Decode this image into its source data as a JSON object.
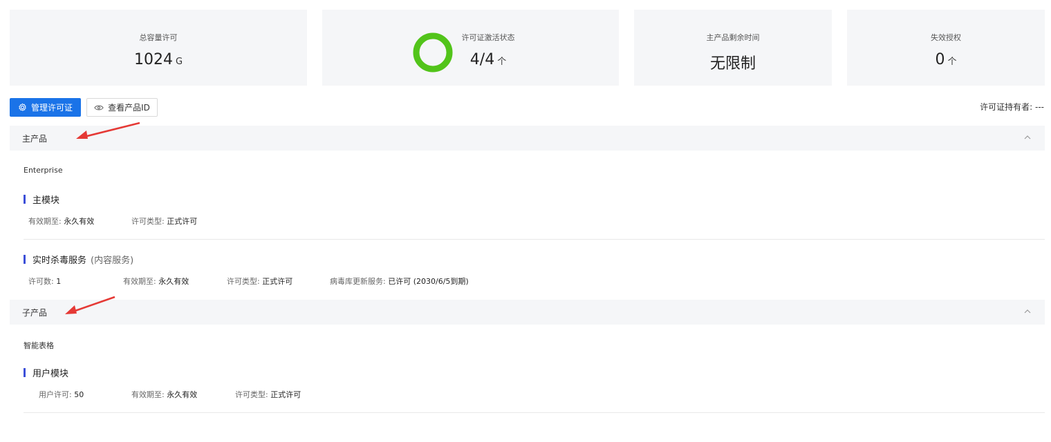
{
  "stats": [
    {
      "label": "总容量许可",
      "value": "1024",
      "unit": "G"
    },
    {
      "label": "许可证激活状态",
      "value": "4/4",
      "unit": "个",
      "progress": 1.0
    },
    {
      "label": "主产品剩余时间",
      "value": "无限制",
      "unit": ""
    },
    {
      "label": "失效授权",
      "value": "0",
      "unit": "个"
    }
  ],
  "colors": {
    "accent": "#1a73e8",
    "ring": "#52c41a",
    "bar": "#3c4fd8",
    "arrow": "#e53935"
  },
  "toolbar": {
    "manage_label": "管理许可证",
    "manage_icon": "gear-icon",
    "view_label": "查看产品ID",
    "view_icon": "eye-icon",
    "holder_label": "许可证持有者:",
    "holder_value": "---"
  },
  "main_product": {
    "header": "主产品",
    "name": "Enterprise",
    "modules": [
      {
        "title": "主模块",
        "sub": "",
        "fields": [
          {
            "label": "有效期至:",
            "value": "永久有效"
          },
          {
            "label": "许可类型:",
            "value": "正式许可"
          }
        ]
      },
      {
        "title": "实时杀毒服务",
        "sub": "(内容服务)",
        "fields": [
          {
            "label": "许可数:",
            "value": "1"
          },
          {
            "label": "有效期至:",
            "value": "永久有效"
          },
          {
            "label": "许可类型:",
            "value": "正式许可"
          },
          {
            "label": "病毒库更新服务:",
            "value": "已许可 (2030/6/5到期)"
          }
        ]
      }
    ]
  },
  "sub_product": {
    "header": "子产品",
    "name": "智能表格",
    "modules": [
      {
        "title": "用户模块",
        "sub": "",
        "fields": [
          {
            "label": "用户许可:",
            "value": "50"
          },
          {
            "label": "有效期至:",
            "value": "永久有效"
          },
          {
            "label": "许可类型:",
            "value": "正式许可"
          }
        ]
      }
    ]
  }
}
